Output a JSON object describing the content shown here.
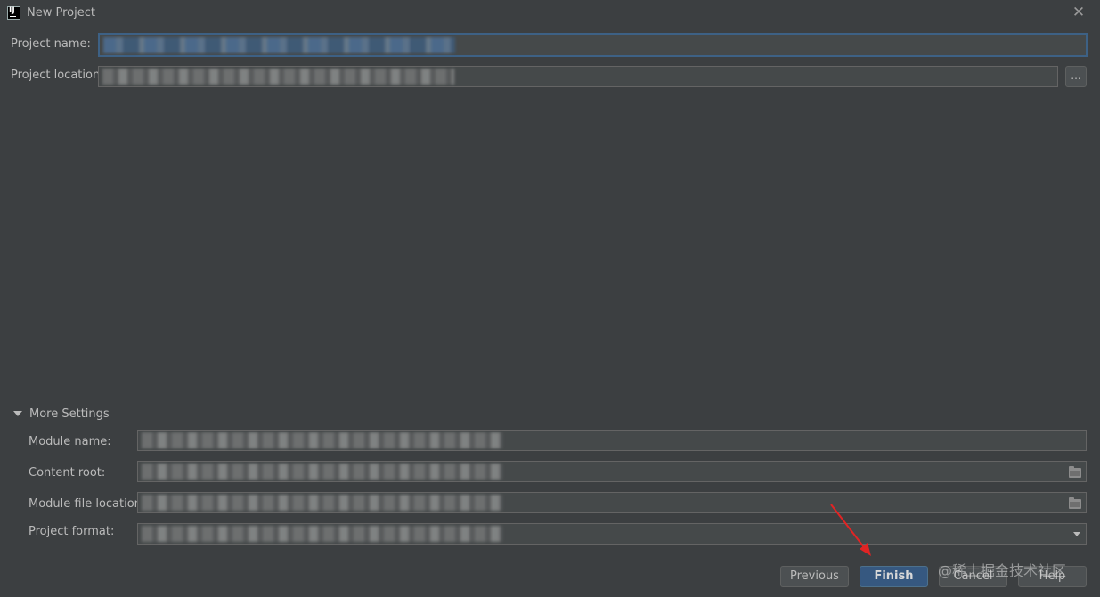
{
  "window": {
    "title": "New Project",
    "app_icon": "intellij-idea-icon",
    "close_glyph": "✕"
  },
  "project": {
    "name_label": "Project name:",
    "location_label": "Project location:",
    "browse_label": "..."
  },
  "more_settings": {
    "label": "More Settings",
    "module_name_label": "Module name:",
    "content_root_label": "Content root:",
    "module_file_location_label": "Module file location:",
    "project_format_label": "Project format:"
  },
  "buttons": {
    "previous": "Previous",
    "finish": "Finish",
    "cancel": "Cancel",
    "help": "Help"
  },
  "watermark": "@稀土掘金技术社区",
  "colors": {
    "background": "#3c3f41",
    "field_background": "#45494a",
    "focus_border": "#3d6185",
    "default_button": "#365880",
    "annotation_arrow": "#e02424"
  }
}
